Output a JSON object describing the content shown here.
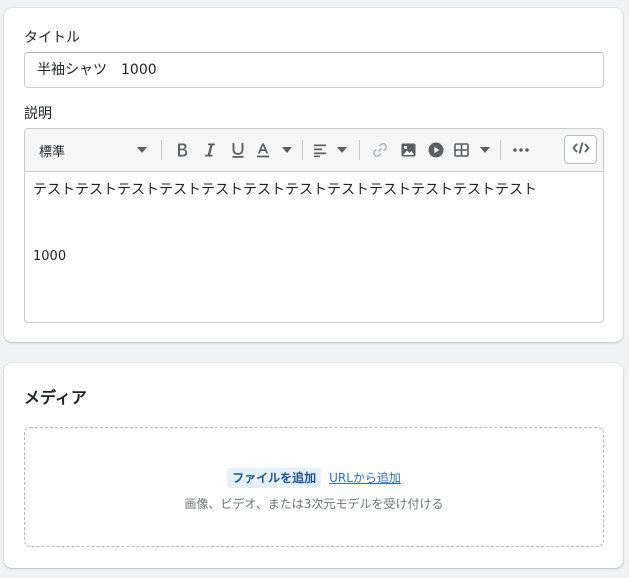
{
  "product": {
    "title_label": "タイトル",
    "title_value": "半袖シャツ　1000",
    "description_label": "説明",
    "editor": {
      "format_select_value": "標準",
      "body_paragraphs": [
        "テストテストテストテストテストテストテストテストテストテストテストテスト",
        "1000"
      ]
    }
  },
  "media": {
    "heading": "メディア",
    "add_file_label": "ファイルを追加",
    "add_url_label": "URLから追加",
    "hint": "画像、ビデオ、または3次元モデルを受け付ける"
  },
  "icons": {
    "format_dropdown": "caret-down-icon",
    "bold": "bold-icon",
    "italic": "italic-icon",
    "underline": "underline-icon",
    "text_color": "text-color-icon",
    "align": "align-left-icon",
    "link": "link-icon",
    "image": "image-icon",
    "video": "play-circle-icon",
    "table": "table-icon",
    "more": "more-horizontal-icon",
    "html": "code-icon"
  },
  "colors": {
    "accent_link": "#2c6ecb",
    "button_bg": "#e4f1fb",
    "page_bg": "#f1f2f4"
  }
}
